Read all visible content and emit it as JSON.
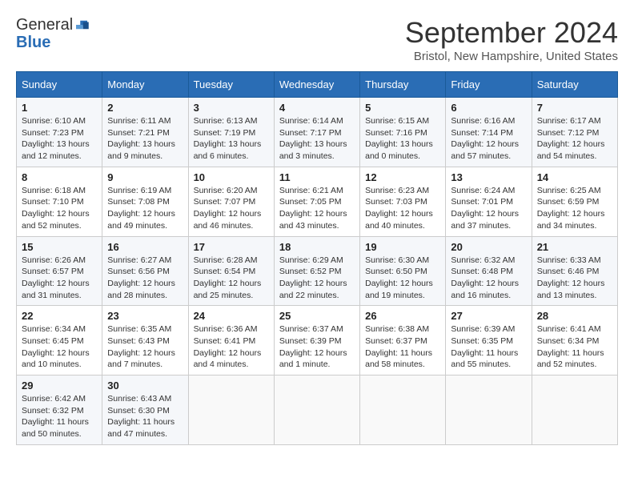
{
  "header": {
    "logo_general": "General",
    "logo_blue": "Blue",
    "title": "September 2024",
    "location": "Bristol, New Hampshire, United States"
  },
  "days_of_week": [
    "Sunday",
    "Monday",
    "Tuesday",
    "Wednesday",
    "Thursday",
    "Friday",
    "Saturday"
  ],
  "weeks": [
    [
      {
        "day": "1",
        "sunrise": "6:10 AM",
        "sunset": "7:23 PM",
        "daylight": "13 hours and 12 minutes"
      },
      {
        "day": "2",
        "sunrise": "6:11 AM",
        "sunset": "7:21 PM",
        "daylight": "13 hours and 9 minutes"
      },
      {
        "day": "3",
        "sunrise": "6:13 AM",
        "sunset": "7:19 PM",
        "daylight": "13 hours and 6 minutes"
      },
      {
        "day": "4",
        "sunrise": "6:14 AM",
        "sunset": "7:17 PM",
        "daylight": "13 hours and 3 minutes"
      },
      {
        "day": "5",
        "sunrise": "6:15 AM",
        "sunset": "7:16 PM",
        "daylight": "13 hours and 0 minutes"
      },
      {
        "day": "6",
        "sunrise": "6:16 AM",
        "sunset": "7:14 PM",
        "daylight": "12 hours and 57 minutes"
      },
      {
        "day": "7",
        "sunrise": "6:17 AM",
        "sunset": "7:12 PM",
        "daylight": "12 hours and 54 minutes"
      }
    ],
    [
      {
        "day": "8",
        "sunrise": "6:18 AM",
        "sunset": "7:10 PM",
        "daylight": "12 hours and 52 minutes"
      },
      {
        "day": "9",
        "sunrise": "6:19 AM",
        "sunset": "7:08 PM",
        "daylight": "12 hours and 49 minutes"
      },
      {
        "day": "10",
        "sunrise": "6:20 AM",
        "sunset": "7:07 PM",
        "daylight": "12 hours and 46 minutes"
      },
      {
        "day": "11",
        "sunrise": "6:21 AM",
        "sunset": "7:05 PM",
        "daylight": "12 hours and 43 minutes"
      },
      {
        "day": "12",
        "sunrise": "6:23 AM",
        "sunset": "7:03 PM",
        "daylight": "12 hours and 40 minutes"
      },
      {
        "day": "13",
        "sunrise": "6:24 AM",
        "sunset": "7:01 PM",
        "daylight": "12 hours and 37 minutes"
      },
      {
        "day": "14",
        "sunrise": "6:25 AM",
        "sunset": "6:59 PM",
        "daylight": "12 hours and 34 minutes"
      }
    ],
    [
      {
        "day": "15",
        "sunrise": "6:26 AM",
        "sunset": "6:57 PM",
        "daylight": "12 hours and 31 minutes"
      },
      {
        "day": "16",
        "sunrise": "6:27 AM",
        "sunset": "6:56 PM",
        "daylight": "12 hours and 28 minutes"
      },
      {
        "day": "17",
        "sunrise": "6:28 AM",
        "sunset": "6:54 PM",
        "daylight": "12 hours and 25 minutes"
      },
      {
        "day": "18",
        "sunrise": "6:29 AM",
        "sunset": "6:52 PM",
        "daylight": "12 hours and 22 minutes"
      },
      {
        "day": "19",
        "sunrise": "6:30 AM",
        "sunset": "6:50 PM",
        "daylight": "12 hours and 19 minutes"
      },
      {
        "day": "20",
        "sunrise": "6:32 AM",
        "sunset": "6:48 PM",
        "daylight": "12 hours and 16 minutes"
      },
      {
        "day": "21",
        "sunrise": "6:33 AM",
        "sunset": "6:46 PM",
        "daylight": "12 hours and 13 minutes"
      }
    ],
    [
      {
        "day": "22",
        "sunrise": "6:34 AM",
        "sunset": "6:45 PM",
        "daylight": "12 hours and 10 minutes"
      },
      {
        "day": "23",
        "sunrise": "6:35 AM",
        "sunset": "6:43 PM",
        "daylight": "12 hours and 7 minutes"
      },
      {
        "day": "24",
        "sunrise": "6:36 AM",
        "sunset": "6:41 PM",
        "daylight": "12 hours and 4 minutes"
      },
      {
        "day": "25",
        "sunrise": "6:37 AM",
        "sunset": "6:39 PM",
        "daylight": "12 hours and 1 minute"
      },
      {
        "day": "26",
        "sunrise": "6:38 AM",
        "sunset": "6:37 PM",
        "daylight": "11 hours and 58 minutes"
      },
      {
        "day": "27",
        "sunrise": "6:39 AM",
        "sunset": "6:35 PM",
        "daylight": "11 hours and 55 minutes"
      },
      {
        "day": "28",
        "sunrise": "6:41 AM",
        "sunset": "6:34 PM",
        "daylight": "11 hours and 52 minutes"
      }
    ],
    [
      {
        "day": "29",
        "sunrise": "6:42 AM",
        "sunset": "6:32 PM",
        "daylight": "11 hours and 50 minutes"
      },
      {
        "day": "30",
        "sunrise": "6:43 AM",
        "sunset": "6:30 PM",
        "daylight": "11 hours and 47 minutes"
      },
      null,
      null,
      null,
      null,
      null
    ]
  ]
}
